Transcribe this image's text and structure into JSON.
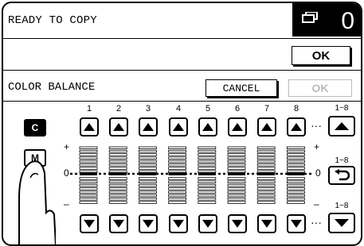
{
  "status": {
    "message": "READY TO COPY",
    "copy_count": "0",
    "copy_icon": "copy-stack-icon"
  },
  "top_ok_label": "OK",
  "panel": {
    "title": "COLOR BALANCE",
    "cancel_label": "CANCEL",
    "ok_label": "OK",
    "ok_enabled": false
  },
  "colors": [
    {
      "label": "C",
      "selected": true
    },
    {
      "label": "M",
      "selected": false
    }
  ],
  "columns": [
    "1",
    "2",
    "3",
    "4",
    "5",
    "6",
    "7",
    "8"
  ],
  "ellipsis": "···",
  "group_label": "1~8",
  "reset_label": "1~8",
  "down_label": "1~8",
  "markers": {
    "plus": "+",
    "zero": "0",
    "minus": "–"
  },
  "colors_theme": {
    "background": "#ffffff",
    "ink": "#000000",
    "disabled": "#bbbbbb"
  }
}
